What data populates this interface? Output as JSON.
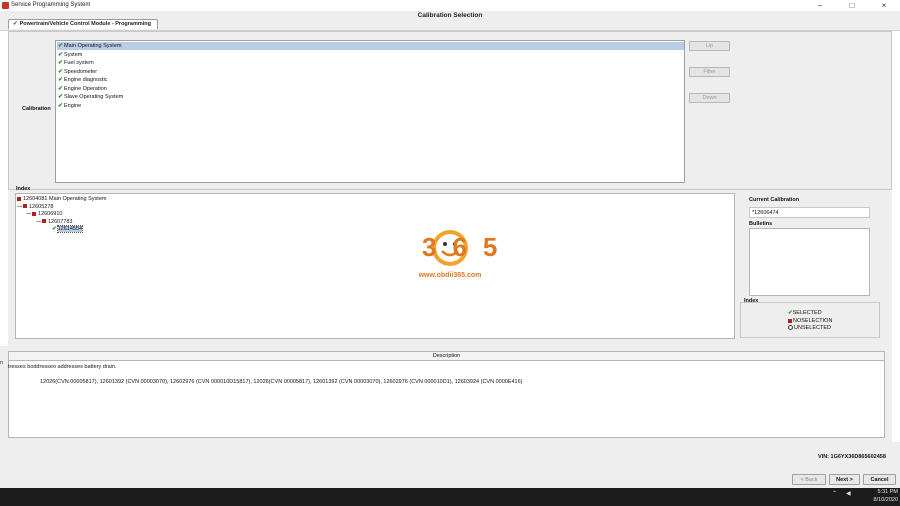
{
  "window": {
    "title": "Service Programming System",
    "minimize": "–",
    "maximize": "□",
    "close": "×"
  },
  "header": {
    "title": "Calibration Selection",
    "tab_label": "Powertrain/Vehicle Control Module - Programming"
  },
  "calibration": {
    "label": "Calibration",
    "items": [
      {
        "label": "Main Operating System",
        "selected": true
      },
      {
        "label": "System",
        "selected": false
      },
      {
        "label": "Fuel system",
        "selected": false
      },
      {
        "label": "Speedometer",
        "selected": false
      },
      {
        "label": "Engine diagnostic",
        "selected": false
      },
      {
        "label": "Engine Operation",
        "selected": false
      },
      {
        "label": "Slave Operating System",
        "selected": false
      },
      {
        "label": "Engine",
        "selected": false
      }
    ],
    "buttons": {
      "up": "Up",
      "filter": "Filter",
      "down": "Down"
    }
  },
  "index": {
    "label": "Index",
    "tree": [
      {
        "label": "12604081 Main Operating System",
        "level": 0,
        "status": "noselection"
      },
      {
        "label": "12605278",
        "level": 1,
        "status": "noselection"
      },
      {
        "label": "12606910",
        "level": 2,
        "status": "noselection"
      },
      {
        "label": "12607783",
        "level": 3,
        "status": "noselection"
      },
      {
        "label": "12614554",
        "level": 4,
        "status": "selected"
      }
    ]
  },
  "current_calibration": {
    "label": "Current Calibration",
    "value": "*12606474"
  },
  "bulletins": {
    "label": "Bulletins"
  },
  "legend": {
    "label": "Index",
    "selected": "SELECTED",
    "noselection": "NOSELECTION",
    "unselected": "UNSELECTED"
  },
  "watermark": {
    "text": "365",
    "url": "www.obdii365.com"
  },
  "description": {
    "header": "Description",
    "marker": "n",
    "line1": "tresses boddresseo addresses battery drain.",
    "line2": "12026(CVN 00005817), 12601392 (CVN 00003070), 12602976 (CVN 000010D15817), 12026(CVN 00005817), 12601392 (CVN 00003070), 12602976 (CVN 000010D1), 12603924 (CVN 0000E416)"
  },
  "footer": {
    "vin": "VIN: 1G6YX36D865602458",
    "back": "< Back",
    "next": "Next >",
    "cancel": "Cancel"
  },
  "taskbar": {
    "time": "5:31 PM",
    "date": "8/10/2020"
  },
  "colors": {
    "selected_row": "#b9cde5",
    "check_green": "#1f8f1f",
    "noselection_red": "#b02020",
    "watermark_orange": "#e07820"
  }
}
